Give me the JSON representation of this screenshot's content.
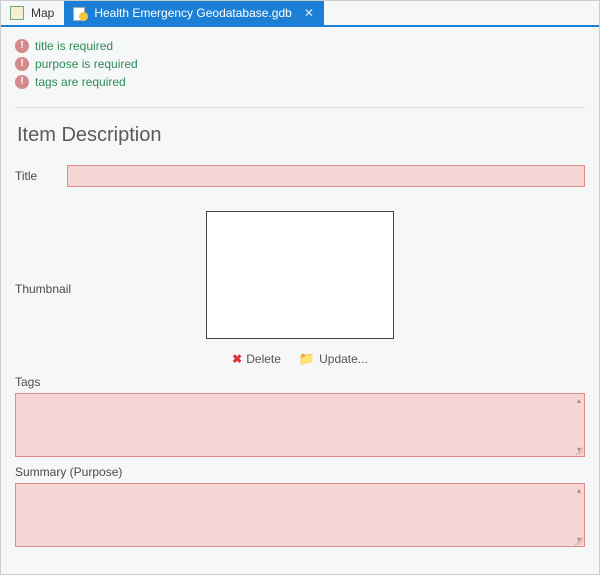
{
  "tabs": {
    "map": {
      "label": "Map"
    },
    "active": {
      "label": "Health Emergency Geodatabase.gdb"
    }
  },
  "validation": {
    "msg0": "title is required",
    "msg1": "purpose is required",
    "msg2": "tags are required"
  },
  "section": {
    "heading": "Item Description"
  },
  "fields": {
    "title_label": "Title",
    "title_value": "",
    "thumbnail_label": "Thumbnail",
    "tags_label": "Tags",
    "tags_value": "",
    "summary_label": "Summary (Purpose)",
    "summary_value": ""
  },
  "thumb_actions": {
    "delete": "Delete",
    "update": "Update..."
  }
}
